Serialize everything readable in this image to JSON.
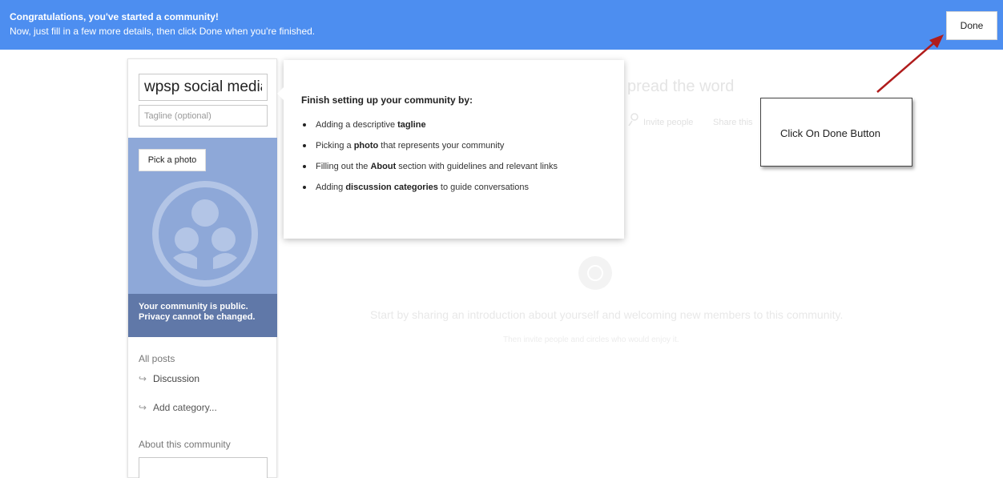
{
  "banner": {
    "title": "Congratulations, you've started a community!",
    "subtitle": "Now, just fill in a few more details, then click Done when you're finished.",
    "done_label": "Done"
  },
  "sidebar": {
    "community_name": "wpsp social media",
    "tagline_placeholder": "Tagline (optional)",
    "pick_photo_label": "Pick a photo",
    "public_note_line1": "Your community is public.",
    "public_note_line2": "Privacy cannot be changed.",
    "nav_heading": "All posts",
    "categories": [
      {
        "label": "Discussion"
      },
      {
        "label": "Add category..."
      }
    ],
    "about_heading": "About this community"
  },
  "tip": {
    "title": "Finish setting up your community by:",
    "items": [
      {
        "before": "Adding a descriptive ",
        "bold": "tagline",
        "after": ""
      },
      {
        "before": "Picking a ",
        "bold": "photo",
        "after": " that represents your community"
      },
      {
        "before": "Filling out the ",
        "bold": "About",
        "after": " section with guidelines and relevant links"
      },
      {
        "before": "Adding ",
        "bold": "discussion categories",
        "after": " to guide conversations"
      }
    ]
  },
  "background": {
    "spread_word": "pread the word",
    "invite_people": "Invite people",
    "share_this": "Share this",
    "start_sharing": "Start by sharing an introduction about yourself and welcoming new members to this community.",
    "then_invite": "Then invite people and circles who would enjoy it."
  },
  "annotation": {
    "text": "Click On Done Button",
    "arrow_color": "#b01c1c"
  },
  "colors": {
    "banner": "#4d8ef0",
    "photo_background": "#8ea8d8"
  },
  "icons": {
    "community_emblem": "community-people-icon",
    "nav_arrow": "subdirectory-arrow-icon",
    "invite": "person-icon"
  }
}
